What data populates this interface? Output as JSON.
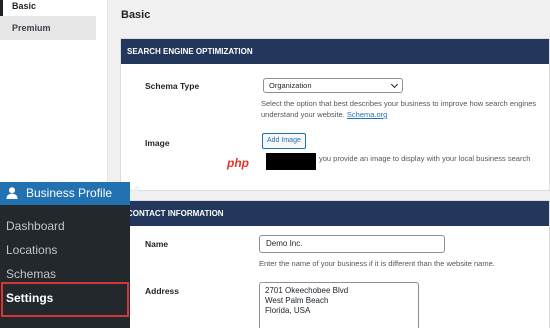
{
  "tabs": {
    "basic": "Basic",
    "premium": "Premium"
  },
  "page_title": "Basic",
  "seo": {
    "title": "SEARCH ENGINE OPTIMIZATION",
    "schema_type_label": "Schema Type",
    "schema_type_value": "Organization",
    "schema_help": "Select the option that best describes your business to improve how search engines understand your website.",
    "schema_link": "Schema.org",
    "image_label": "Image",
    "add_image_button": "Add Image",
    "image_help": "you provide an image to display with your local business search",
    "watermark": "php"
  },
  "contact": {
    "title": "CONTACT INFORMATION",
    "name_label": "Name",
    "name_value": "Demo Inc.",
    "name_help": "Enter the name of your business if it is different than the website name.",
    "address_label": "Address",
    "address_line1": "2701 Okeechobee Blvd",
    "address_line2": "West Palm Beach",
    "address_line3": "Florida, USA"
  },
  "admin_menu": {
    "header": "Business Profile",
    "items": [
      {
        "label": "Dashboard"
      },
      {
        "label": "Locations"
      },
      {
        "label": "Schemas"
      },
      {
        "label": "Settings"
      }
    ]
  },
  "colors": {
    "section_header": "#23375c",
    "admin_bg": "#23282d",
    "admin_accent": "#2271b1",
    "highlight": "#d63638",
    "link": "#2271b1"
  }
}
